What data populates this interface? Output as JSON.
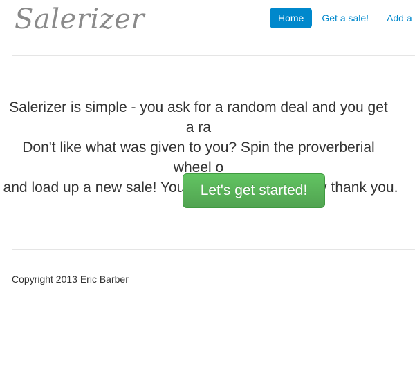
{
  "header": {
    "logo": "Salerizer",
    "nav": [
      {
        "label": "Home",
        "active": true
      },
      {
        "label": "Get a sale!",
        "active": false
      },
      {
        "label": "Add a",
        "active": false
      }
    ]
  },
  "main": {
    "lead_lines": [
      "Salerizer is simple - you ask for a random deal and you get a ra",
      "Don't like what was given to you? Spin the proverberial wheel o",
      "and load up a new sale! Your wallet will most likely thank you."
    ],
    "cta_label": "Let's get started!"
  },
  "footer": {
    "copyright": "Copyright 2013 Eric Barber"
  },
  "colors": {
    "accent": "#0088cc",
    "cta_green": "#5bb75b",
    "logo_gray": "#8a8a8a",
    "divider": "#e5e5e5"
  }
}
